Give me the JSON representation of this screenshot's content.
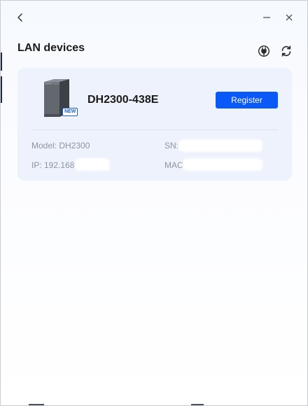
{
  "window": {
    "back_icon": "chevron-left-icon",
    "minimize_icon": "minimize-icon",
    "close_icon": "close-icon"
  },
  "header": {
    "title": "LAN devices",
    "tools": [
      {
        "icon": "plug-icon"
      },
      {
        "icon": "refresh-icon"
      }
    ]
  },
  "device": {
    "name": "DH2300-438E",
    "badge": "NEW",
    "register_label": "Register",
    "model": "Model: DH2300",
    "sn": "SN:",
    "ip": "IP: 192.168",
    "mac": "MAC"
  },
  "colors": {
    "accent": "#0a58f5",
    "card_bg": "#edf2fc",
    "muted_text": "#8e959f"
  }
}
